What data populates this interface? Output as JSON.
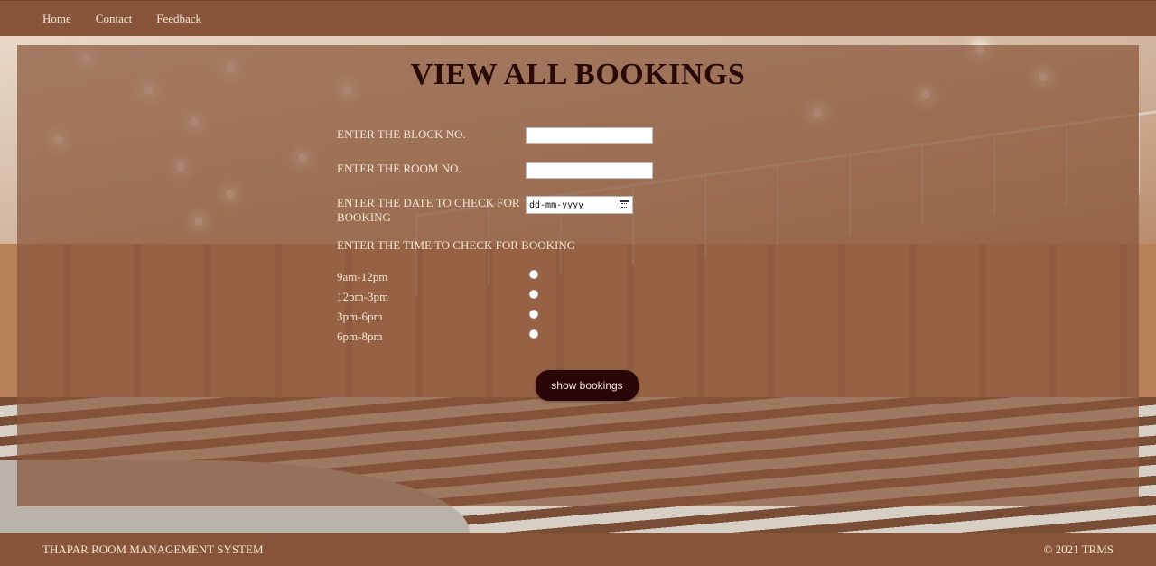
{
  "nav": {
    "links": [
      "Home",
      "Contact",
      "Feedback"
    ]
  },
  "page": {
    "title": "VIEW ALL BOOKINGS"
  },
  "form": {
    "block_label": "ENTER THE BLOCK NO.",
    "block_value": "",
    "room_label": "ENTER THE ROOM NO.",
    "room_value": "",
    "date_label_line1": "ENTER THE DATE TO CHECK FOR",
    "date_label_line2": "BOOKING",
    "date_placeholder": "dd-mm-yyyy",
    "time_label": "ENTER THE TIME TO CHECK FOR BOOKING",
    "time_slots": [
      "9am-12pm",
      "12pm-3pm",
      "3pm-6pm",
      "6pm-8pm"
    ],
    "submit_label": "show bookings"
  },
  "footer": {
    "left": "THAPAR ROOM MANAGEMENT SYSTEM",
    "right": "© 2021 TRMS"
  },
  "colors": {
    "bar": "#88553a",
    "overlay": "#89563a",
    "title": "#2a0a08",
    "button": "#2b0608"
  }
}
